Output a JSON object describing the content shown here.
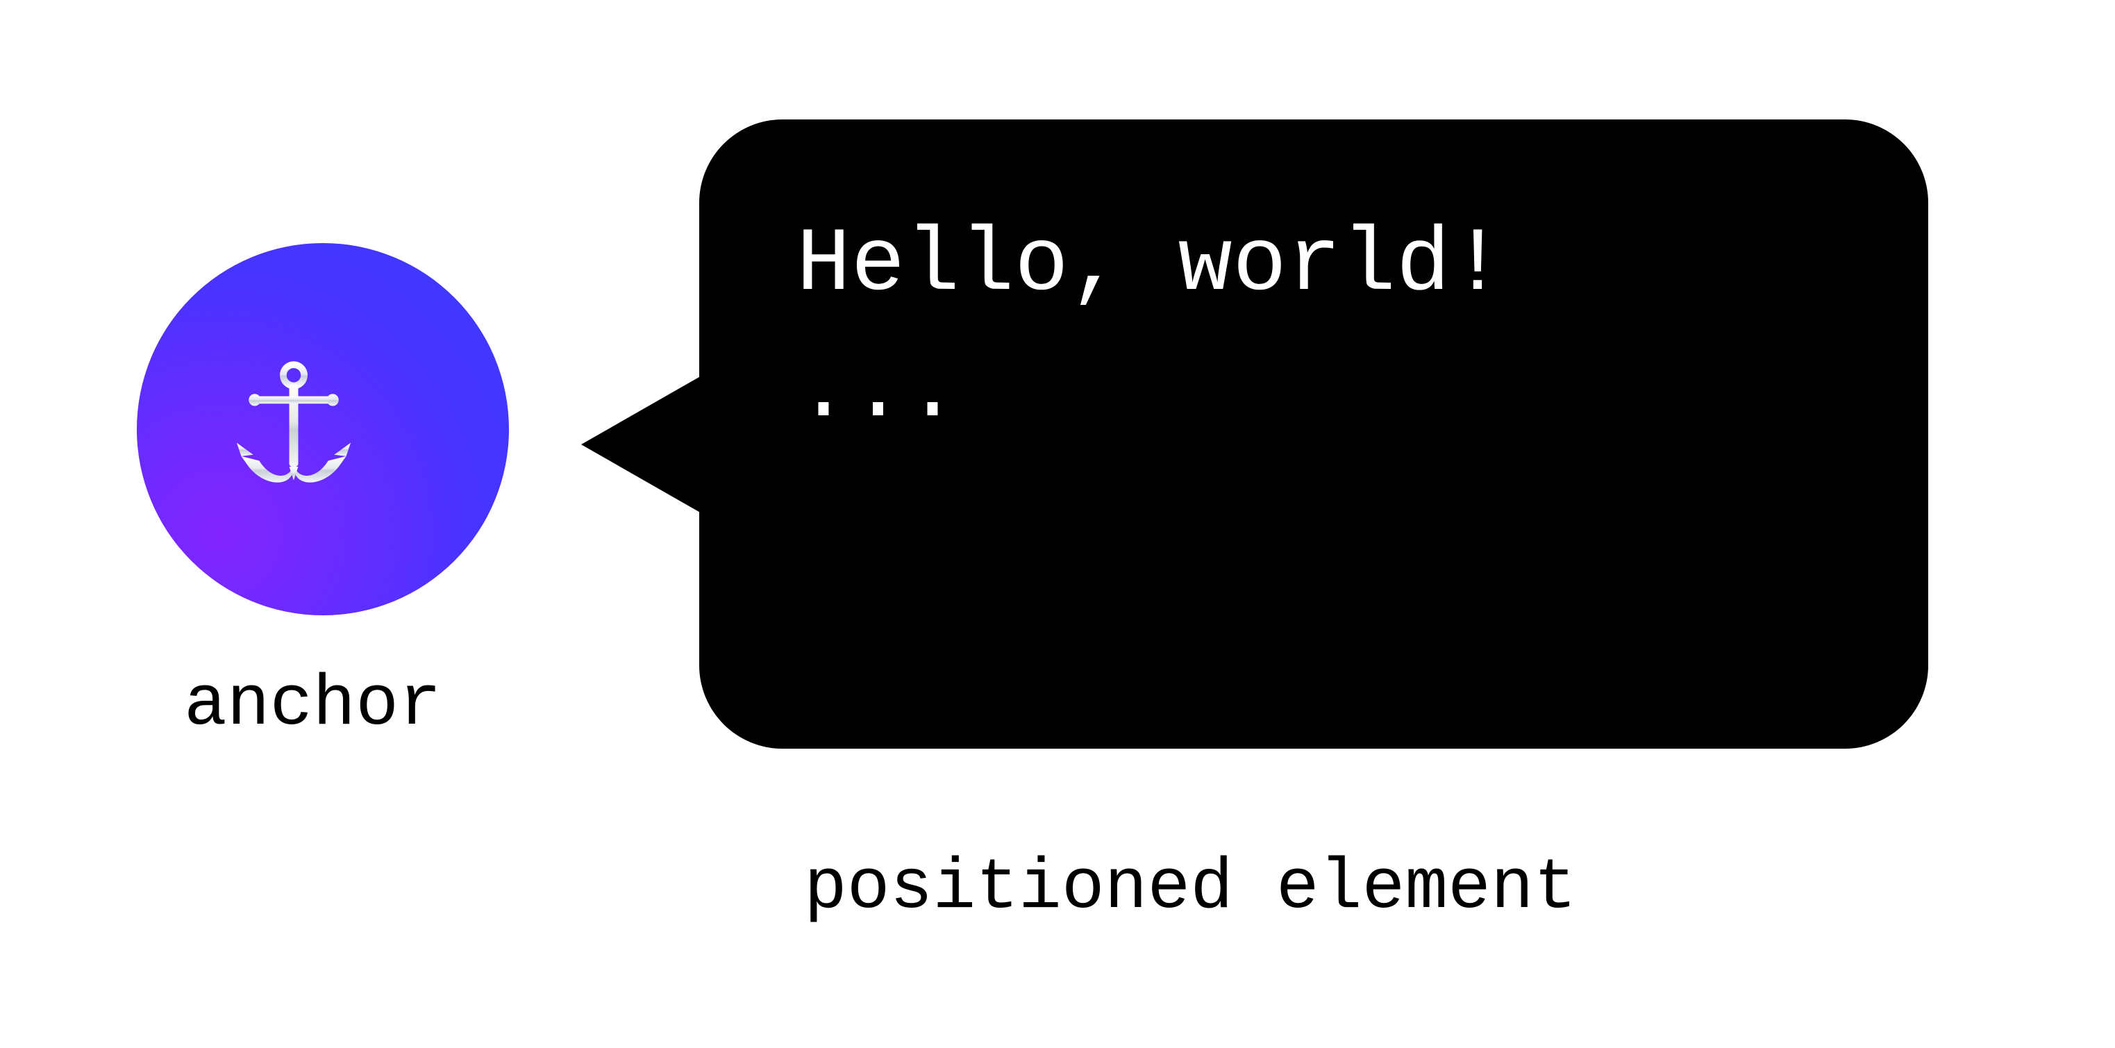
{
  "anchor": {
    "label": "anchor",
    "icon_name": "anchor-icon",
    "gradient": {
      "from": "#8224ff",
      "to": "#3a3bff"
    }
  },
  "bubble": {
    "line1": "Hello, world!",
    "line2": "...",
    "bg": "#000000",
    "fg": "#ffffff"
  },
  "positioned": {
    "label": "positioned element"
  }
}
